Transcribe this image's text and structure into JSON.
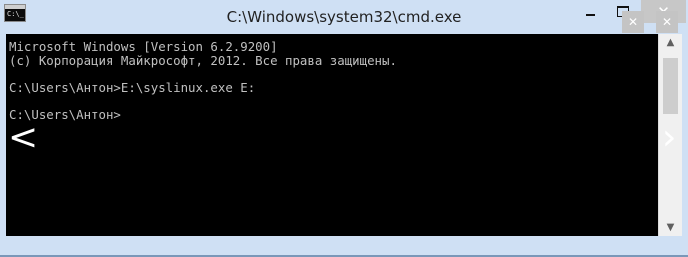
{
  "window": {
    "title": "C:\\Windows\\system32\\cmd.exe",
    "icon_text": "C:\\_",
    "icon_name": "cmd-app-icon",
    "controls": {
      "minimize_icon": "minimize-icon",
      "maximize_icon": "maximize-icon",
      "close_symbol": "✕"
    },
    "accent_color": "#cfe0f4"
  },
  "console": {
    "text": "Microsoft Windows [Version 6.2.9200]\n(c) Корпорация Майкрософт, 2012. Все права защищены.\n\nC:\\Users\\Антон>E:\\syslinux.exe E:\n\nC:\\Users\\Антон>",
    "background": "#000000",
    "foreground": "#c0c0c0"
  },
  "overlay": {
    "back_glyph": "<",
    "forward_glyph": "›",
    "btn_a_symbol": "✕",
    "btn_b_symbol": "✕"
  },
  "scrollbar": {
    "up_arrow": "▲",
    "down_arrow": "▼"
  }
}
